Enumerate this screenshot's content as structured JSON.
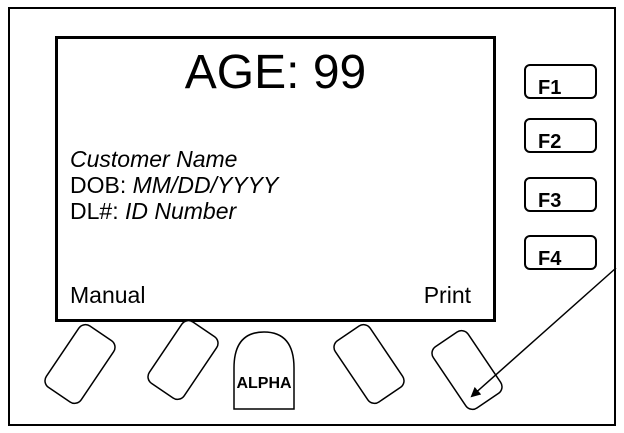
{
  "display": {
    "age_label": "AGE: 99",
    "customer_name": "Customer Name",
    "dob_label": "DOB:",
    "dob_value": "MM/DD/YYYY",
    "dl_label": "DL#:",
    "dl_value": "ID Number",
    "softkey_left": "Manual",
    "softkey_right": "Print"
  },
  "function_keys": [
    "F1",
    "F2",
    "F3",
    "F4"
  ],
  "keypad": {
    "alpha_label": "ALPHA"
  }
}
